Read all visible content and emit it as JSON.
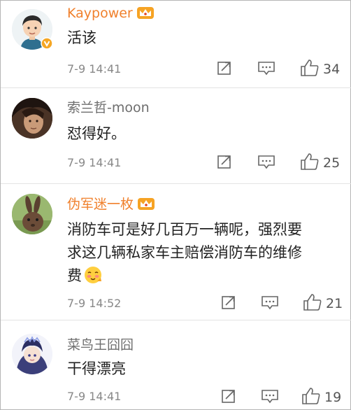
{
  "comments": [
    {
      "username": "Kaypower",
      "username_color": "#f0802c",
      "vip_badge": "crown-icon",
      "verified_badge": "verified-v-icon",
      "text": "活该",
      "time": "7-9 14:41",
      "likes": "34"
    },
    {
      "username": "索兰哲-moon",
      "username_color": "#6e6e6e",
      "text": "怼得好。",
      "time": "7-9 14:41",
      "likes": "25"
    },
    {
      "username": "伪军迷一枚",
      "username_color": "#f0802c",
      "vip_badge": "crown-icon",
      "text_line1": "消防车可是好几百万一辆呢，强烈要",
      "text_line2": "求这几辆私家车主赔偿消防车的维修",
      "text_line3": "费",
      "emoji": "blushing-face-emoji",
      "time": "7-9 14:52",
      "likes": "21"
    },
    {
      "username": "菜鸟王囧囧",
      "username_color": "#6e6e6e",
      "text": "干得漂亮",
      "time": "7-9 14:41",
      "likes": "19"
    }
  ],
  "actions": {
    "share_icon": "share-icon",
    "reply_icon": "comment-icon",
    "like_icon": "thumbs-up-icon"
  }
}
